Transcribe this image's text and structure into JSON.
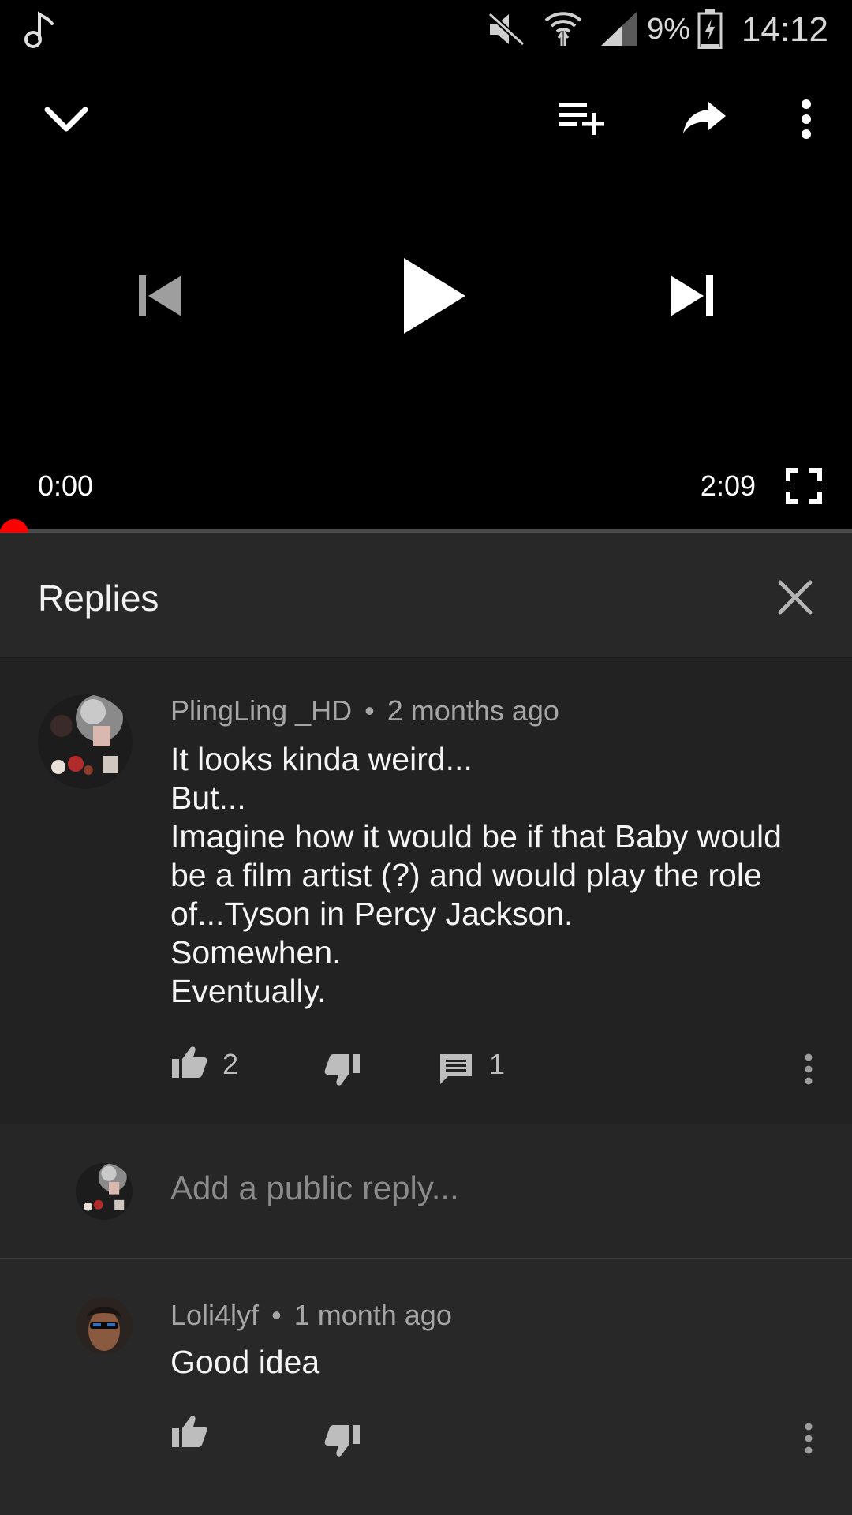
{
  "status_bar": {
    "battery": "9%",
    "time": "14:12",
    "icons": [
      "music-note-icon",
      "mute-icon",
      "wifi-icon",
      "signal-icon",
      "battery-icon"
    ]
  },
  "player": {
    "current_time": "0:00",
    "duration": "2:09",
    "progress": 0.0,
    "icons": [
      "chevron-down-icon",
      "add-to-queue-icon",
      "share-icon",
      "more-vert-icon",
      "previous-icon",
      "play-icon",
      "next-icon",
      "fullscreen-icon"
    ]
  },
  "replies_panel": {
    "title": "Replies",
    "close_icon": "close-icon"
  },
  "comment": {
    "author": "PlingLing _HD",
    "separator": "•",
    "age": "2 months ago",
    "text": "It looks kinda weird...\nBut...\nImagine how it would be if that Baby would be a film artist (?) and would play the role of...Tyson in Percy Jackson.\nSomewhen.\nEventually.",
    "likes": "2",
    "replies": "1"
  },
  "reply_input": {
    "placeholder": "Add a public reply..."
  },
  "replies": [
    {
      "author": "Loli4lyf",
      "separator": "•",
      "age": "1 month ago",
      "text": "Good idea"
    }
  ],
  "colors": {
    "accent": "#ff0000",
    "background": "#222222",
    "header": "#282828",
    "player": "#000000"
  }
}
